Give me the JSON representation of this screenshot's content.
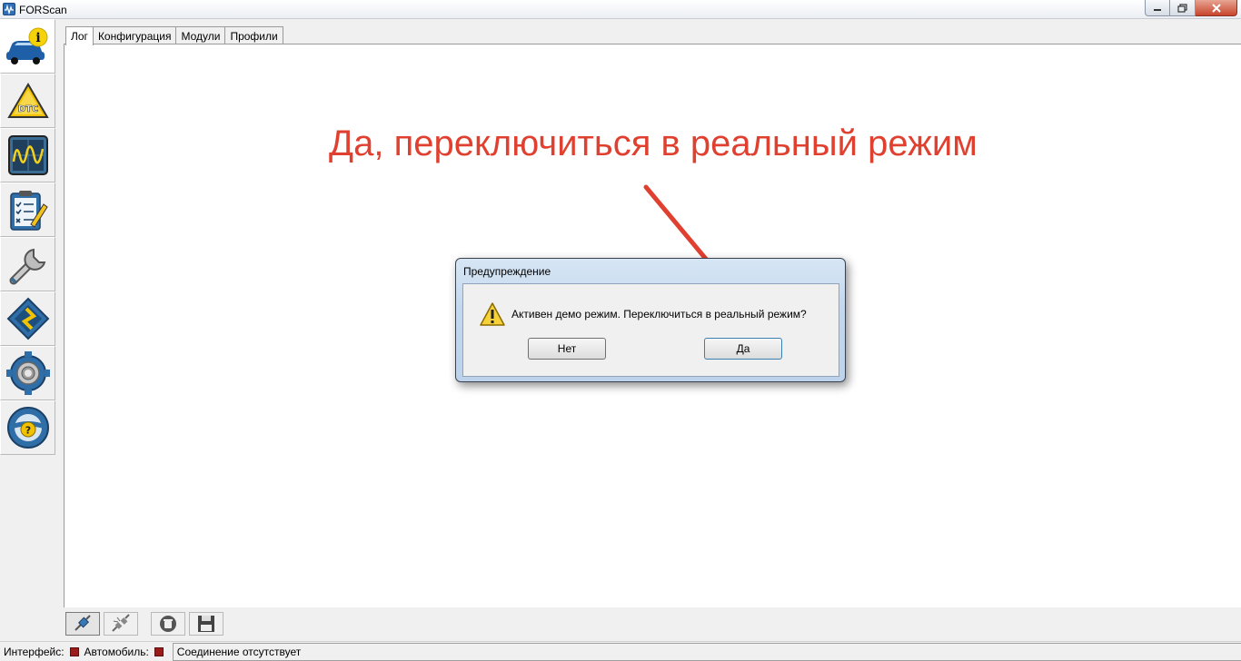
{
  "window": {
    "title": "FORScan",
    "controls": [
      "minimize-icon",
      "maximize-icon",
      "close-icon"
    ]
  },
  "sidebar": {
    "items": [
      {
        "name": "vehicle-info",
        "icon": "car-info-icon",
        "active": true
      },
      {
        "name": "dtc",
        "icon": "dtc-warning-icon",
        "active": false
      },
      {
        "name": "oscilloscope",
        "icon": "oscilloscope-icon",
        "active": false
      },
      {
        "name": "tests",
        "icon": "checklist-icon",
        "active": false
      },
      {
        "name": "service",
        "icon": "wrench-icon",
        "active": false
      },
      {
        "name": "modules-programming",
        "icon": "chip-icon",
        "active": false
      },
      {
        "name": "settings",
        "icon": "gear-icon",
        "active": false
      },
      {
        "name": "help",
        "icon": "help-wheel-icon",
        "active": false
      }
    ]
  },
  "tabs": [
    {
      "label": "Лог",
      "active": true
    },
    {
      "label": "Конфигурация",
      "active": false
    },
    {
      "label": "Модули",
      "active": false
    },
    {
      "label": "Профили",
      "active": false
    }
  ],
  "annotation": {
    "text": "Да, переключиться в реальный режим",
    "color": "#e0402f"
  },
  "dialog": {
    "title": "Предупреждение",
    "icon": "warning-icon",
    "message": "Активен демо режим. Переключиться в реальный режим?",
    "buttons": {
      "no": "Нет",
      "yes": "Да"
    }
  },
  "bottom_toolbar": {
    "buttons": [
      "connect-icon",
      "disconnect-icon",
      "clear-log-icon",
      "save-icon"
    ]
  },
  "status": {
    "interface_label": "Интерфейс:",
    "vehicle_label": "Автомобиль:",
    "message": "Соединение отсутствует",
    "led_color": "#9b1b1b"
  }
}
